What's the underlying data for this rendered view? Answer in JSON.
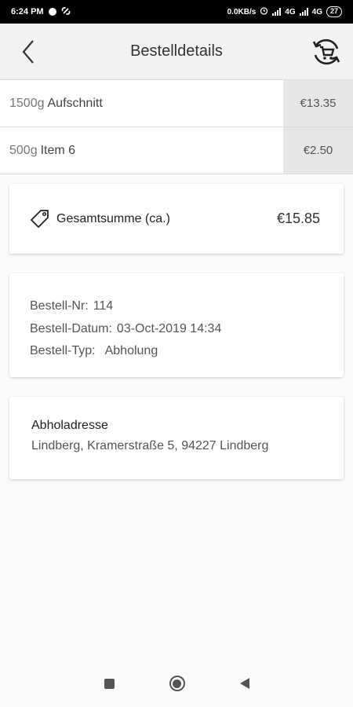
{
  "status_bar": {
    "time": "6:24 PM",
    "network_speed": "0.0KB/s",
    "network_type_1": "4G",
    "network_type_2": "4G",
    "battery": "27",
    "icons": [
      "circle-icon",
      "link-icon",
      "alarm-icon",
      "signal-icon",
      "signal-icon",
      "battery-icon"
    ]
  },
  "header": {
    "title": "Bestelldetails",
    "back_icon": "chevron-left-icon",
    "reorder_icon": "cart-refresh-icon"
  },
  "items": [
    {
      "qty": "1500g",
      "name": "Aufschnitt",
      "price": "€13.35"
    },
    {
      "qty": "500g",
      "name": "Item 6",
      "price": "€2.50"
    }
  ],
  "total": {
    "icon": "tag-icon",
    "label": "Gesamtsumme (ca.)",
    "value": "€15.85"
  },
  "order_info": {
    "number_label": "Bestell-Nr:",
    "number_value": "114",
    "date_label": "Bestell-Datum:",
    "date_value": "03-Oct-2019 14:34",
    "type_label": "Bestell-Typ:",
    "type_value": "Abholung"
  },
  "pickup": {
    "title": "Abholadresse",
    "address": "Lindberg, Kramerstraße 5, 94227 Lindberg"
  },
  "nav": {
    "icons": [
      "recents-square-icon",
      "home-circle-icon",
      "back-triangle-icon"
    ]
  }
}
